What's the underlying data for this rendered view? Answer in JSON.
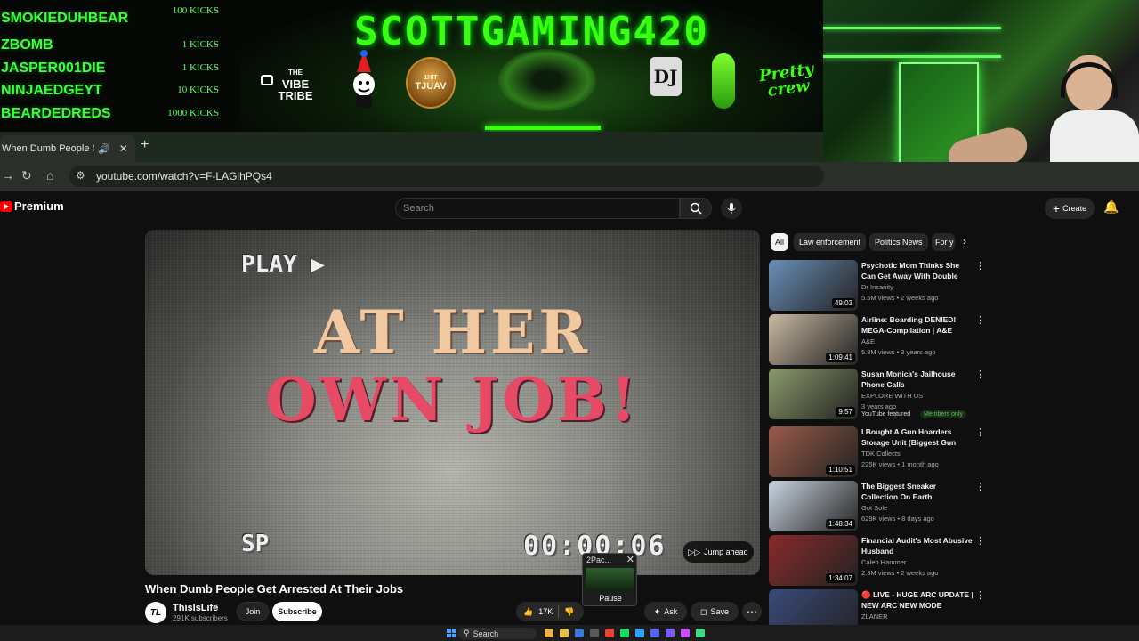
{
  "overlay": {
    "kicks": [
      {
        "name": "SMOKIEDUHBEAR",
        "amount": "100 KICKS"
      },
      {
        "name": "ZBOMB",
        "amount": "1 KICKS"
      },
      {
        "name": "JASPER001DIE",
        "amount": "1 KICKS"
      },
      {
        "name": "NINJAEDGEYT",
        "amount": "10 KICKS"
      },
      {
        "name": "BEARDEDREDS",
        "amount": "1000 KICKS"
      }
    ],
    "banner_title": "SCOTTGAMING420",
    "sponsors": {
      "vibe_top": "THE",
      "vibe_main": "VIBE",
      "vibe_bottom": "TRIBE",
      "bear_top": "1HIT",
      "bear_main": "TJUAV",
      "dj": "DJ",
      "pretty_line1": "Pretty",
      "pretty_line2": "crew"
    }
  },
  "browser": {
    "tab_title": "When Dumb People Get Arrested At Their Jobs",
    "url": "youtube.com/watch?v=F-LAGlhPQs4",
    "icons": [
      "back-arrow-icon",
      "reload-icon",
      "home-icon",
      "site-settings-icon"
    ]
  },
  "youtube": {
    "logo_text": "Premium",
    "search_placeholder": "Search",
    "create_label": "Create",
    "player": {
      "osd_play": "PLAY ▶",
      "line1": "AT HER",
      "line2": "OWN JOB!",
      "osd_sp": "SP",
      "osd_time": "00:00:06",
      "jump_ahead": "Jump ahead"
    },
    "media_popup": {
      "title": "2Pac...",
      "pause": "Pause"
    },
    "video": {
      "title": "When Dumb People Get Arrested At Their Jobs",
      "channel": "ThisIsLife",
      "channel_avatar": "TL",
      "subscribers": "291K subscribers",
      "join": "Join",
      "subscribe": "Subscribe",
      "likes": "17K",
      "ask": "Ask",
      "save": "Save"
    },
    "chips": [
      "All",
      "Law enforcement",
      "Politics News",
      "For y"
    ],
    "recommendations": [
      {
        "title": "Psychotic Mom Thinks She Can Get Away With Double Murder",
        "channel": "Dr Insanity",
        "meta": "5.5M views • 2 weeks ago",
        "duration": "49:03",
        "thumb_color": "#6a8fb8"
      },
      {
        "title": "Airline: Boarding DENIED! MEGA-Compilation | A&E",
        "channel": "A&E",
        "meta": "5.8M views • 3 years ago",
        "duration": "1:09:41",
        "thumb_color": "#c9b9a2"
      },
      {
        "title": "Susan Monica's Jailhouse Phone Calls",
        "channel": "EXPLORE WITH US",
        "meta": "3 years ago",
        "duration": "9:57",
        "thumb_color": "#8a9a6a",
        "featured": "YouTube featured",
        "members": "Members only"
      },
      {
        "title": "I Bought A Gun Hoarders Storage Unit (Biggest Gun Fin...",
        "channel": "TDK Collects",
        "meta": "225K views • 1 month ago",
        "duration": "1:10:51",
        "thumb_color": "#9a5a4a"
      },
      {
        "title": "The Biggest Sneaker Collection On Earth ($8,000,000+)",
        "channel": "Got Sole",
        "meta": "629K views • 8 days ago",
        "duration": "1:48:34",
        "thumb_color": "#c9d4e0"
      },
      {
        "title": "Financial Audit's Most Abusive Husband",
        "channel": "Caleb Hammer",
        "meta": "2.3M views • 2 weeks ago",
        "duration": "1:34:07",
        "thumb_color": "#8a2a2a"
      },
      {
        "title": "🔴 LIVE - HUGE ARC UPDATE | NEW ARC NEW MODE",
        "channel": "ZLANER",
        "meta": "",
        "duration": "",
        "thumb_color": "#3a4a7a"
      }
    ]
  },
  "taskbar": {
    "search": "Search",
    "pinned_colors": [
      "#e8b24a",
      "#e4c04a",
      "#3b78d8",
      "#5a5a5a",
      "#ea4335",
      "#1ed760",
      "#2fa0ff",
      "#5865f2",
      "#7b5cff",
      "#c84fff",
      "#3ddc84"
    ]
  }
}
